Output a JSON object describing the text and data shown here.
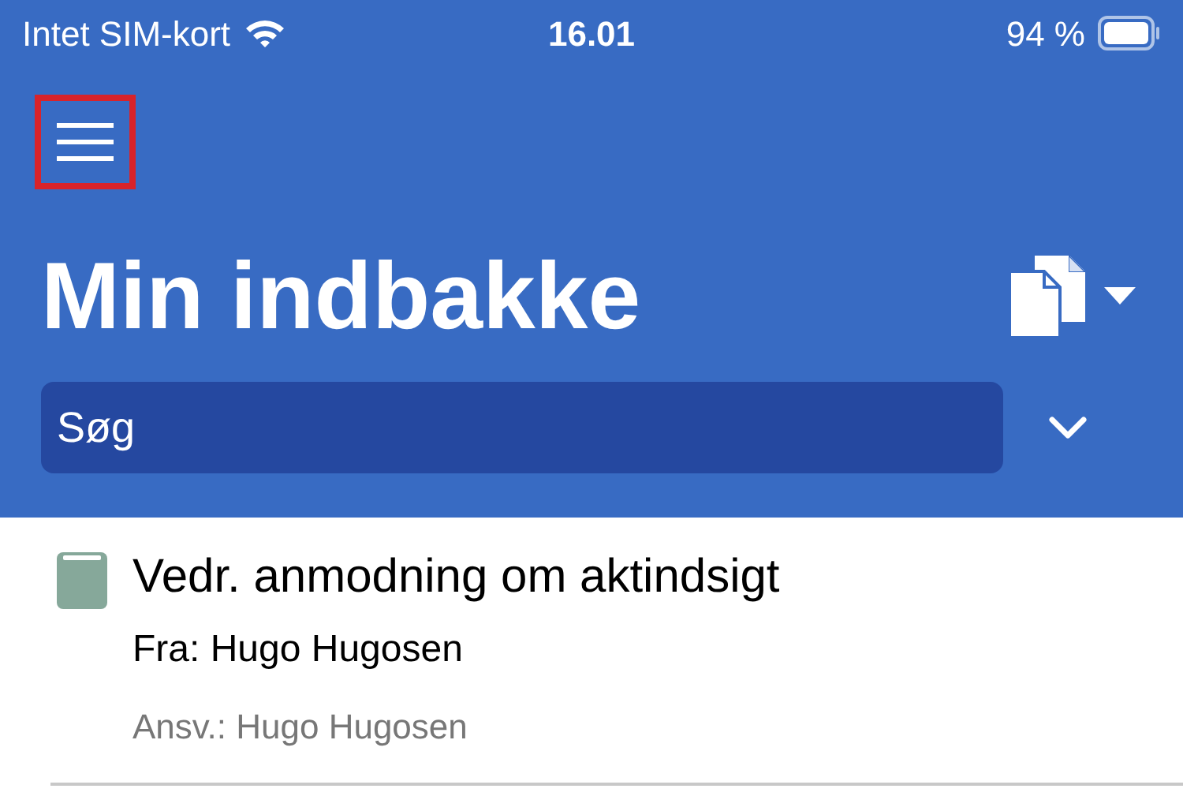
{
  "status_bar": {
    "carrier": "Intet SIM-kort",
    "time": "16.01",
    "battery": "94 %"
  },
  "menu_button": {
    "highlighted": true
  },
  "title": "Min indbakke",
  "search": {
    "placeholder": "Søg"
  },
  "items": [
    {
      "title": "Vedr. anmodning om aktindsigt",
      "from": "Fra: Hugo Hugosen",
      "responsible": "Ansv.: Hugo Hugosen"
    }
  ]
}
